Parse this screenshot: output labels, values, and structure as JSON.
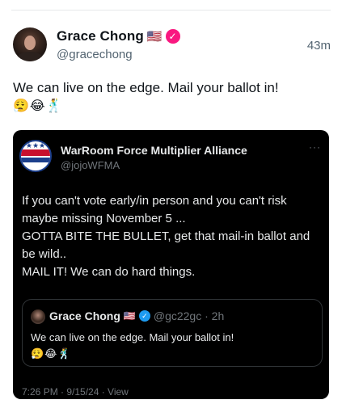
{
  "post": {
    "author": {
      "display_name": "Grace Chong",
      "flag": "🇺🇸",
      "verified_glyph": "✓",
      "handle": "@gracechong"
    },
    "timestamp": "43m",
    "text": "We can live on the edge. Mail your ballot in!",
    "emojis": "😮‍💨😂🕺"
  },
  "embedded": {
    "author": {
      "display_name": "WarRoom Force Multiplier Alliance",
      "handle": "@jojoWFMA"
    },
    "more_glyph": "···",
    "body_lines": [
      "If you can't vote early/in person and you can't risk maybe missing November 5 ...",
      "GOTTA BITE THE BULLET, get that mail-in ballot and be wild..",
      "MAIL IT!  We can do hard things."
    ],
    "quote": {
      "display_name": "Grace Chong",
      "flag": "🇺🇸",
      "verified_glyph": "✓",
      "handle_time": "@gc22gc · 2h",
      "text": "We can live on the edge. Mail your ballot in!",
      "emojis": "😮‍💨😂🕺"
    },
    "footer": "7:26 PM · 9/15/24 · View"
  },
  "colors": {
    "verified_badge": "#f91880",
    "quote_verified_badge": "#1d9bf0",
    "embed_background": "#000000",
    "secondary_text": "#536471"
  }
}
